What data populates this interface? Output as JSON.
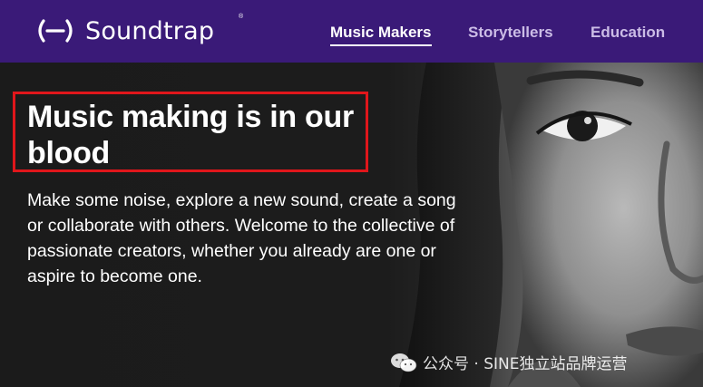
{
  "header": {
    "logo_text": "Soundtrap",
    "logo_registered": "®",
    "nav": [
      {
        "label": "Music Makers",
        "active": true
      },
      {
        "label": "Storytellers",
        "active": false
      },
      {
        "label": "Education",
        "active": false
      }
    ]
  },
  "hero": {
    "headline": "Music making is in our blood",
    "description": "Make some noise, explore a new sound, create a song or collaborate with others. Welcome to the collective of passionate creators, whether you already are one or aspire to become one.",
    "highlight_color": "#e0161b"
  },
  "watermark": {
    "text": "公众号 · SINE独立站品牌运营",
    "icon": "wechat-icon"
  },
  "colors": {
    "header_bg": "#3a1a78",
    "hero_bg": "#1b1b1b"
  }
}
